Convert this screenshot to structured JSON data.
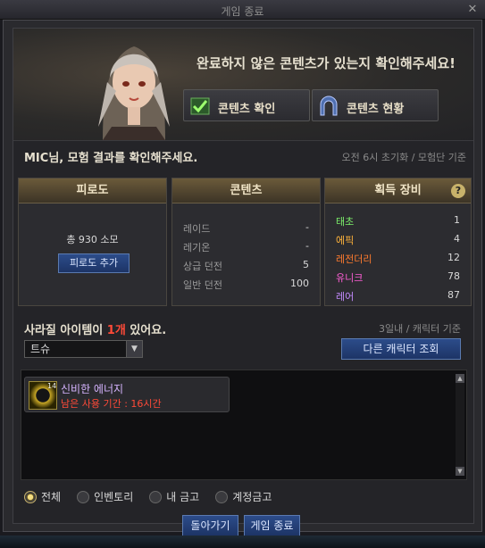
{
  "window": {
    "title": "게임 종료"
  },
  "header": {
    "message": "완료하지 않은 콘텐츠가 있는지 확인해주세요!",
    "content_check_label": "콘텐츠 확인",
    "content_status_label": "콘텐츠 현황"
  },
  "result": {
    "title": "MIC님, 모험 결과를 확인해주세요.",
    "reset_info": "오전 6시 초기화 / 모험단 기준"
  },
  "fatigue": {
    "title": "피로도",
    "total": "총 930 소모",
    "add_label": "피로도 추가"
  },
  "content": {
    "title": "콘텐츠",
    "rows": [
      {
        "name": "레이드",
        "value": "-"
      },
      {
        "name": "레기온",
        "value": "-"
      },
      {
        "name": "상급 던전",
        "value": "5"
      },
      {
        "name": "일반 던전",
        "value": "100"
      }
    ]
  },
  "gear": {
    "title": "획득 장비",
    "rows": [
      {
        "name": "태초",
        "value": "1",
        "color": "#7cf06a"
      },
      {
        "name": "에픽",
        "value": "4",
        "color": "#ffb33b"
      },
      {
        "name": "레전더리",
        "value": "12",
        "color": "#ff7b2e"
      },
      {
        "name": "유니크",
        "value": "78",
        "color": "#ff5fd6"
      },
      {
        "name": "레어",
        "value": "87",
        "color": "#c48bff"
      }
    ]
  },
  "disappear": {
    "title_prefix": "사라질 아이템이 ",
    "count": "1개",
    "title_suffix": " 있어요.",
    "basis": "3일내 / 캐릭터 기준",
    "dropdown_value": "트슈",
    "other_char_label": "다른 캐릭터 조회"
  },
  "items": [
    {
      "name": "신비한 에너지",
      "period": "남은 사용 기간 : 16시간",
      "tag": "14"
    }
  ],
  "filters": [
    {
      "label": "전체",
      "selected": true
    },
    {
      "label": "인벤토리",
      "selected": false
    },
    {
      "label": "내 금고",
      "selected": false
    },
    {
      "label": "계정금고",
      "selected": false
    }
  ],
  "bottom": {
    "back_label": "돌아가기",
    "end_label": "게임 종료"
  }
}
